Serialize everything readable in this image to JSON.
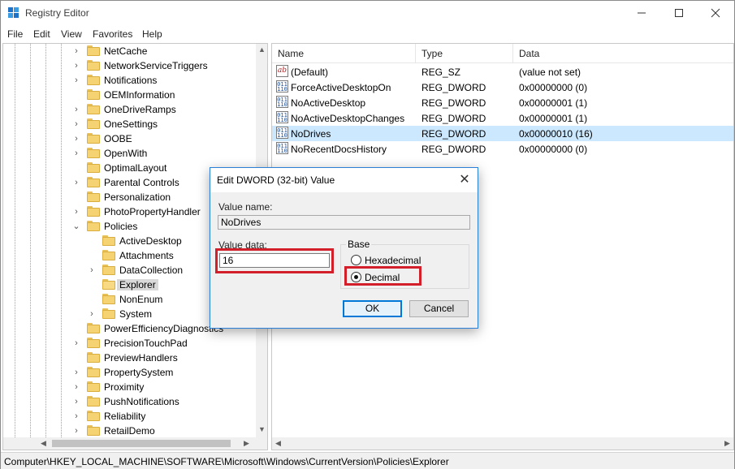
{
  "window": {
    "title": "Registry Editor"
  },
  "menu": [
    "File",
    "Edit",
    "View",
    "Favorites",
    "Help"
  ],
  "tree": {
    "items": [
      {
        "label": "NetCache",
        "expander": "›"
      },
      {
        "label": "NetworkServiceTriggers",
        "expander": "›"
      },
      {
        "label": "Notifications",
        "expander": "›"
      },
      {
        "label": "OEMInformation",
        "expander": ""
      },
      {
        "label": "OneDriveRamps",
        "expander": "›"
      },
      {
        "label": "OneSettings",
        "expander": "›"
      },
      {
        "label": "OOBE",
        "expander": "›"
      },
      {
        "label": "OpenWith",
        "expander": "›"
      },
      {
        "label": "OptimalLayout",
        "expander": ""
      },
      {
        "label": "Parental Controls",
        "expander": "›"
      },
      {
        "label": "Personalization",
        "expander": ""
      },
      {
        "label": "PhotoPropertyHandler",
        "expander": "›"
      },
      {
        "label": "Policies",
        "expander": "⌄"
      },
      {
        "label": "ActiveDesktop",
        "expander": ""
      },
      {
        "label": "Attachments",
        "expander": ""
      },
      {
        "label": "DataCollection",
        "expander": "›"
      },
      {
        "label": "Explorer",
        "expander": ""
      },
      {
        "label": "NonEnum",
        "expander": ""
      },
      {
        "label": "System",
        "expander": "›"
      },
      {
        "label": "PowerEfficiencyDiagnostics",
        "expander": ""
      },
      {
        "label": "PrecisionTouchPad",
        "expander": "›"
      },
      {
        "label": "PreviewHandlers",
        "expander": ""
      },
      {
        "label": "PropertySystem",
        "expander": "›"
      },
      {
        "label": "Proximity",
        "expander": "›"
      },
      {
        "label": "PushNotifications",
        "expander": "›"
      },
      {
        "label": "Reliability",
        "expander": "›"
      },
      {
        "label": "RetailDemo",
        "expander": "›"
      }
    ],
    "selected": "Explorer"
  },
  "list": {
    "columns": [
      "Name",
      "Type",
      "Data"
    ],
    "rows": [
      {
        "name": "(Default)",
        "type": "REG_SZ",
        "data": "(value not set)",
        "icon": "string-value-icon"
      },
      {
        "name": "ForceActiveDesktopOn",
        "type": "REG_DWORD",
        "data": "0x00000000 (0)",
        "icon": "binary-value-icon"
      },
      {
        "name": "NoActiveDesktop",
        "type": "REG_DWORD",
        "data": "0x00000001 (1)",
        "icon": "binary-value-icon"
      },
      {
        "name": "NoActiveDesktopChanges",
        "type": "REG_DWORD",
        "data": "0x00000001 (1)",
        "icon": "binary-value-icon"
      },
      {
        "name": "NoDrives",
        "type": "REG_DWORD",
        "data": "0x00000010 (16)",
        "icon": "binary-value-icon"
      },
      {
        "name": "NoRecentDocsHistory",
        "type": "REG_DWORD",
        "data": "0x00000000 (0)",
        "icon": "binary-value-icon"
      }
    ],
    "selected": "NoDrives"
  },
  "status": {
    "path": "Computer\\HKEY_LOCAL_MACHINE\\SOFTWARE\\Microsoft\\Windows\\CurrentVersion\\Policies\\Explorer"
  },
  "dialog": {
    "title": "Edit DWORD (32-bit) Value",
    "value_name_label": "Value name:",
    "value_name": "NoDrives",
    "value_data_label": "Value data:",
    "value_data": "16",
    "base_label": "Base",
    "hex_label": "Hexadecimal",
    "dec_label": "Decimal",
    "selected_base": "Decimal",
    "ok_label": "OK",
    "cancel_label": "Cancel"
  },
  "colors": {
    "highlight": "#d21f2a",
    "selection": "#cce8ff",
    "accent": "#0078d7"
  }
}
